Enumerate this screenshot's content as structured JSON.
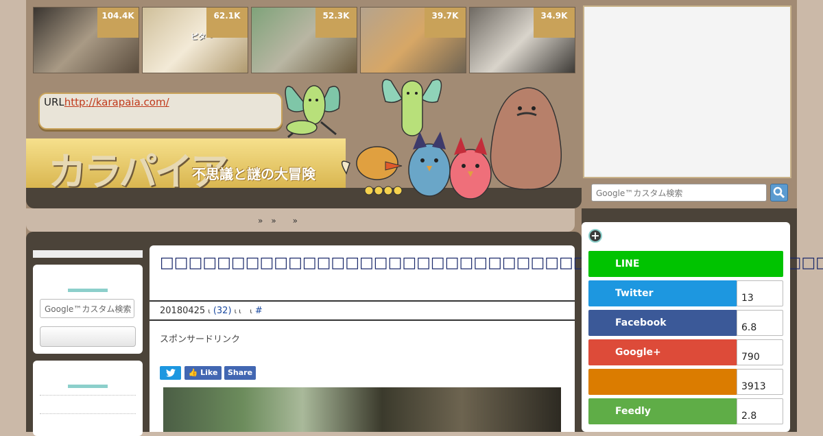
{
  "thumbnails": [
    {
      "count": "104.4K",
      "colors": [
        "#3a3530",
        "#a99a85",
        "#5b4d3e"
      ]
    },
    {
      "count": "62.1K",
      "colors": [
        "#cfbf9a",
        "#f3ead7",
        "#b09a6f"
      ],
      "caption": "ピタ〜"
    },
    {
      "count": "52.3K",
      "colors": [
        "#7fa37a",
        "#b9b6a3",
        "#6b5a3d"
      ]
    },
    {
      "count": "39.7K",
      "colors": [
        "#b5a38d",
        "#d7a766",
        "#6e6353"
      ]
    },
    {
      "count": "34.9K",
      "colors": [
        "#6f6a63",
        "#d9d4cb",
        "#3d3a36"
      ]
    }
  ],
  "header": {
    "url_label": "URL",
    "url_link": "http://karapaia.com/",
    "logo_text": "カラパイア",
    "tagline": "不思議と謎の大冒険"
  },
  "breadcrumb": "»　»　　»",
  "sidebar": {
    "search_placeholder": "Google™カスタム検索"
  },
  "article": {
    "title": "□□□□□□□□□□□□□□□□□□□□□□□□□□□□□□□□□□□□□□□□□□□□□□□□□",
    "date": "20180425",
    "comments": "(32)",
    "hash": "#",
    "sponsor": "スポンサードリンク",
    "buttons": {
      "twitter_icon": "twitter-bird",
      "fb_like": "Like",
      "fb_share": "Share"
    }
  },
  "right": {
    "search_placeholder": "Google™カスタム検索",
    "share_rows": [
      {
        "label": "LINE",
        "count": "",
        "color": "#00c300"
      },
      {
        "label": "Twitter",
        "count": "13",
        "color": "#1d97e0"
      },
      {
        "label": "Facebook",
        "count": "6.8",
        "color": "#3b5998"
      },
      {
        "label": "Google+",
        "count": "790",
        "color": "#dd4b39"
      },
      {
        "label": "",
        "count": "3913",
        "color": "#db7c00"
      },
      {
        "label": "Feedly",
        "count": "2.8",
        "color": "#5fad47"
      }
    ]
  }
}
